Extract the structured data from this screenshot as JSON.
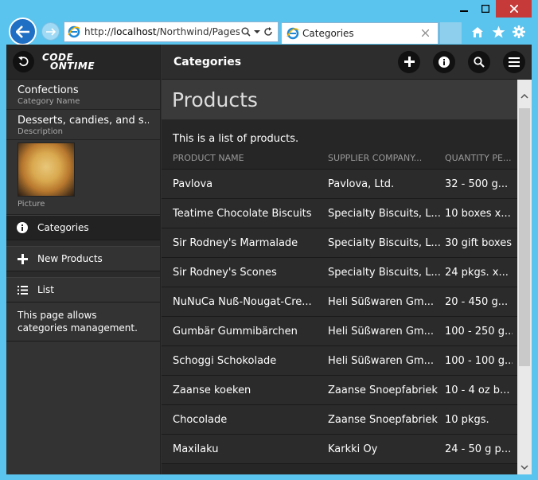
{
  "browser": {
    "url_prefix": "http://",
    "url_host": "localhost",
    "url_path": "/Northwind/Pages/C",
    "tab_title": "Categories"
  },
  "sidebar": {
    "fields": [
      {
        "value": "Confections",
        "label": "Category Name"
      },
      {
        "value": "Desserts, candies, and s...",
        "label": "Description"
      }
    ],
    "picture_label": "Picture",
    "items": [
      {
        "label": "Categories",
        "icon": "info-icon"
      },
      {
        "label": "New Products",
        "icon": "plus-icon"
      },
      {
        "label": "List",
        "icon": "list-icon"
      }
    ],
    "note": "This page allows categories management."
  },
  "brand": {
    "line1": "CODE",
    "line2": "ONTIME"
  },
  "main": {
    "title": "Categories",
    "page_header": "Products",
    "description": "This is a list of products.",
    "columns": [
      "PRODUCT NAME",
      "SUPPLIER COMPANY...",
      "QUANTITY PE..."
    ],
    "rows": [
      [
        "Pavlova",
        "Pavlova, Ltd.",
        "32 - 500 g..."
      ],
      [
        "Teatime Chocolate Biscuits",
        "Specialty Biscuits, L...",
        "10 boxes x..."
      ],
      [
        "Sir Rodney's Marmalade",
        "Specialty Biscuits, L...",
        "30 gift boxes"
      ],
      [
        "Sir Rodney's Scones",
        "Specialty Biscuits, L...",
        "24 pkgs. x..."
      ],
      [
        "NuNuCa Nuß-Nougat-Cre...",
        "Heli Süßwaren Gm...",
        "20 - 450 g..."
      ],
      [
        "Gumbär Gummibärchen",
        "Heli Süßwaren Gm...",
        "100 - 250 g..."
      ],
      [
        "Schoggi Schokolade",
        "Heli Süßwaren Gm...",
        "100 - 100 g..."
      ],
      [
        "Zaanse koeken",
        "Zaanse Snoepfabriek",
        "10 - 4 oz b..."
      ],
      [
        "Chocolade",
        "Zaanse Snoepfabriek",
        "10 pkgs."
      ],
      [
        "Maxilaku",
        "Karkki Oy",
        "24 - 50 g p..."
      ]
    ]
  }
}
